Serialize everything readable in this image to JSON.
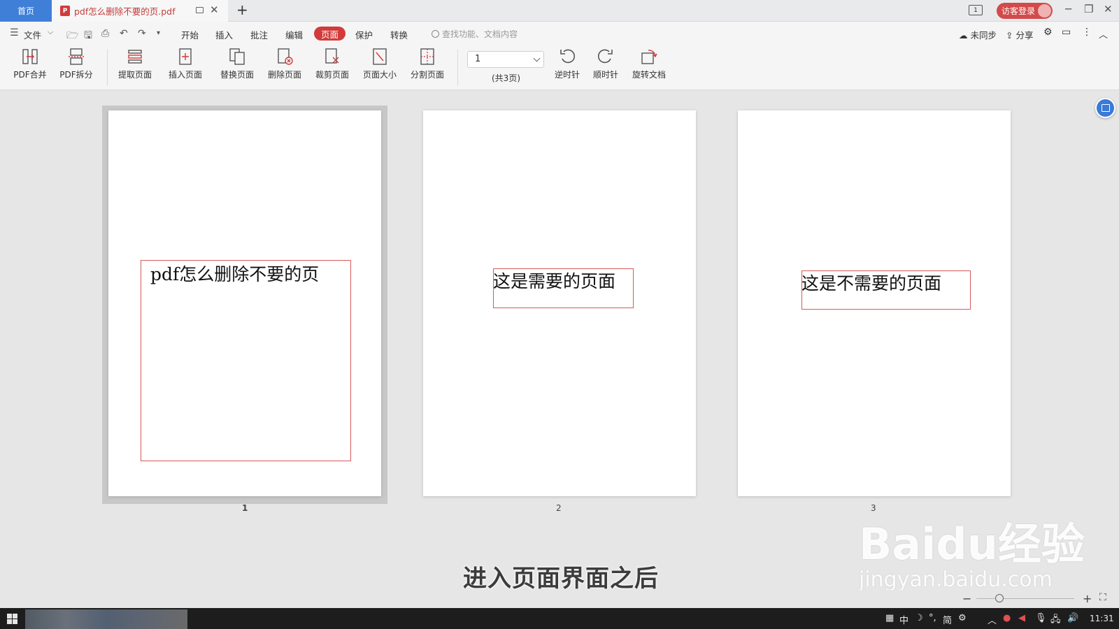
{
  "tabs": {
    "home": "首页",
    "document": "pdf怎么删除不要的页.pdf",
    "add": "+"
  },
  "titlebar": {
    "view_icon_label": "1",
    "visitor_login": "访客登录",
    "minimize": "─",
    "restore": "❐",
    "close": "✕"
  },
  "menu": {
    "file": "文件",
    "items": [
      "开始",
      "插入",
      "批注",
      "编辑",
      "页面",
      "保护",
      "转换"
    ],
    "active": "页面",
    "search_placeholder": "查找功能、文档内容",
    "unsynced": "未同步",
    "share": "分享"
  },
  "ribbon": {
    "merge": "PDF合并",
    "split": "PDF拆分",
    "extract": "提取页面",
    "insert": "插入页面",
    "replace": "替换页面",
    "delete": "删除页面",
    "crop": "裁剪页面",
    "page_size": "页面大小",
    "divide": "分割页面",
    "page_value": "1",
    "page_total": "(共3页)",
    "counterclockwise": "逆时针",
    "clockwise": "顺时针",
    "rotate_doc": "旋转文档"
  },
  "pages": [
    {
      "number": "1",
      "text": "pdf怎么删除不要的页"
    },
    {
      "number": "2",
      "text": "这是需要的页面"
    },
    {
      "number": "3",
      "text": "这是不需要的页面"
    }
  ],
  "caption": "进入页面界面之后",
  "watermark": {
    "main": "Baidu经验",
    "sub": "jingyan.baidu.com"
  },
  "zoom": {
    "minus": "−",
    "plus": "+"
  },
  "taskbar": {
    "ime_items": [
      "中",
      "简"
    ],
    "time": "11:31"
  },
  "colors": {
    "accent_red": "#d33a3a",
    "home_tab_blue": "#3f7fd8",
    "page_box_red": "#d65a5a"
  }
}
